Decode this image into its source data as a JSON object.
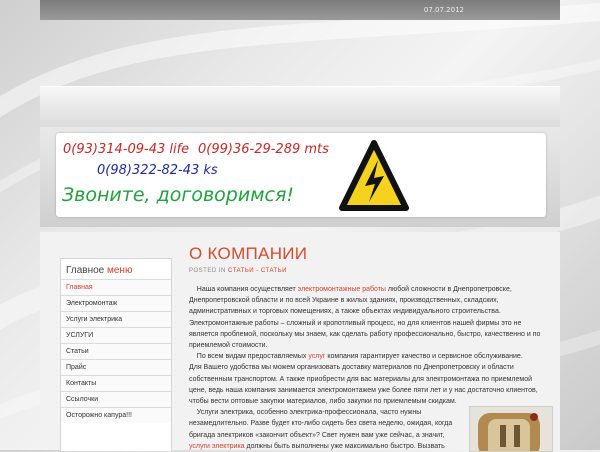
{
  "header": {
    "date": "07.07.2012"
  },
  "banner": {
    "phone_life": "0(93)314-09-43 life",
    "phone_mts": "0(99)36-29-289 mts",
    "phone_ks": "0(98)322-82-43 ks",
    "slogan": "Звоните, договоримся!"
  },
  "sidebar": {
    "title_main": "Главное ",
    "title_accent": "меню",
    "items": [
      {
        "label": "Главная"
      },
      {
        "label": "Электромонтаж"
      },
      {
        "label": "Услуги электрика"
      },
      {
        "label": "УСЛУГИ"
      },
      {
        "label": "Статьи"
      },
      {
        "label": "Прайс"
      },
      {
        "label": "Контакты"
      },
      {
        "label": "Ссылочки"
      },
      {
        "label": "Осторожно капура!!!"
      }
    ]
  },
  "article": {
    "title": "О КОМПАНИИ",
    "posted_prefix": "POSTED IN ",
    "posted_link": "СТАТЬИ - СТАТЬИ",
    "p1_start": "Наша компания осуществляет ",
    "p1_link": "электромонтажные работы",
    "p1_end": " любой сложности в Днепропетровске, Днепропетровской  области и по всей Украине в жилых зданиях, производственных, складских, административных и торговых помещениях, а также объектах индивидуального строительства. Электромонтажные работы – сложный и кропотливый процесс, но для клиентов нашей фирмы это не является проблемой, поскольку мы знаем, как сделать работу профессионально, быстро, качественно и по приемлемой стоимости.",
    "p2_start": "По всем видам предоставляемых ",
    "p2_link": "услуг",
    "p2_end": " компания гарантирует качество и сервисное обслуживание.",
    "p3": "Для Вашего удобства мы можем организовать доставку материалов по Днепропетровску и области собственным транспортом. А также приобрести для вас материалы для электромонтажа по приемлемой цене, ведь наша компания занимается электромонтажем уже более пяти лет и у нас достаточно клиентов, чтобы вести оптовые закупки материалов, либо закупки по приемлемым скидкам.",
    "p4": "Услуги электрика, особенно электрика-профессионала, часто нужны незамедлительно. Разве будет кто-либо сидеть без света неделю, ожидая, когда бригада электриков «закончит объект»? Свет нужен вам уже сейчас, а значит,",
    "p5_link": "услуги электрика",
    "p5_end": " должны быть выполнены уже максимально быстро. Вызвать"
  }
}
